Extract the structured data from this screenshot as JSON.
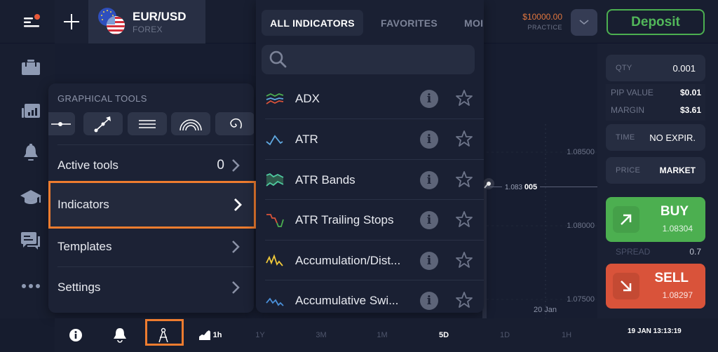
{
  "header": {
    "asset": {
      "name": "EUR/USD",
      "type": "FOREX",
      "icon": "eur-usd-flags-icon"
    },
    "balance": {
      "amount": "$10000.00",
      "account_type": "PRACTICE"
    },
    "deposit_label": "Deposit",
    "colors": {
      "balance": "#e0763e",
      "deposit": "#52b75a"
    }
  },
  "sidebar": {
    "items": [
      {
        "icon": "portfolio-icon",
        "label": "Portfolio"
      },
      {
        "icon": "chart-icon",
        "label": "Chart"
      },
      {
        "icon": "bell-icon",
        "label": "Alerts"
      },
      {
        "icon": "education-icon",
        "label": "Education"
      },
      {
        "icon": "chat-icon",
        "label": "Chat"
      },
      {
        "icon": "more-icon",
        "label": "More"
      }
    ]
  },
  "tools_panel": {
    "title": "GRAPHICAL TOOLS",
    "tools": [
      "horizontal-line",
      "trend-line",
      "parallel-lines",
      "fibonacci-arcs",
      "spiral"
    ],
    "menu": [
      {
        "label": "Active tools",
        "count": "0"
      },
      {
        "label": "Indicators",
        "count": ""
      },
      {
        "label": "Templates",
        "count": ""
      },
      {
        "label": "Settings",
        "count": ""
      }
    ]
  },
  "indicators_panel": {
    "tabs": [
      "ALL INDICATORS",
      "FAVORITES",
      "MOI"
    ],
    "search_placeholder": "",
    "items": [
      {
        "name": "ADX",
        "icon": "adx-icon"
      },
      {
        "name": "ATR",
        "icon": "atr-icon"
      },
      {
        "name": "ATR Bands",
        "icon": "atr-bands-icon"
      },
      {
        "name": "ATR Trailing Stops",
        "icon": "atr-trailing-stops-icon"
      },
      {
        "name": "Accumulation/Dist...",
        "icon": "accumulation-distribution-icon"
      },
      {
        "name": "Accumulative Swi...",
        "icon": "accumulative-swing-icon"
      }
    ]
  },
  "chart": {
    "y_labels": [
      "1.08500",
      "1.08000",
      "1.07500"
    ],
    "x_labels": [
      "20 Jan"
    ],
    "current_price_prefix": "1.083",
    "current_price_suffix": "005"
  },
  "trade_panel": {
    "qty": {
      "label": "QTY",
      "value": "0.001"
    },
    "pip_value": {
      "label": "PIP VALUE",
      "value": "$0.01"
    },
    "margin": {
      "label": "MARGIN",
      "value": "$3.61"
    },
    "time": {
      "label": "TIME",
      "value": "NO EXPIR."
    },
    "price": {
      "label": "PRICE",
      "value": "MARKET"
    },
    "buy": {
      "label": "BUY",
      "price": "1.08304",
      "color": "#4caf50"
    },
    "spread": {
      "label": "SPREAD",
      "value": "0.7"
    },
    "sell": {
      "label": "SELL",
      "price": "1.08297",
      "color": "#d9533a"
    }
  },
  "bottom_bar": {
    "chart_type_label": "1h",
    "periods": [
      "1Y",
      "3M",
      "1M",
      "5D",
      "1D",
      "1H"
    ],
    "active_period": "5D",
    "clock": "19 JAN 13:13:19"
  }
}
